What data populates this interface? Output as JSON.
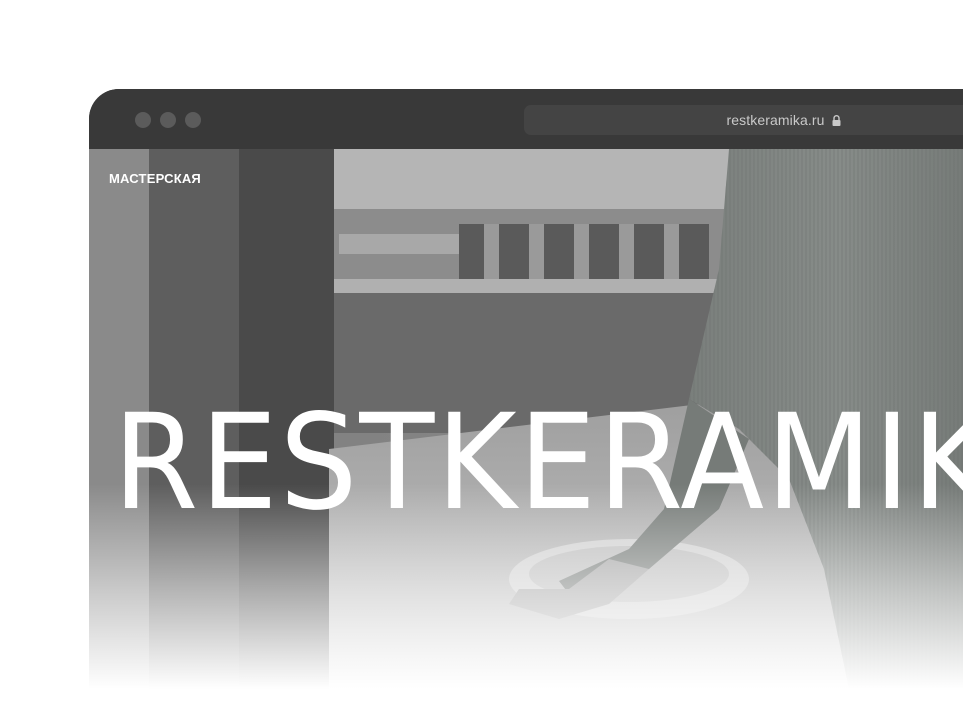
{
  "browser": {
    "url": "restkeramika.ru",
    "window_controls": [
      "close",
      "minimize",
      "maximize"
    ],
    "lock_icon": "lock-icon"
  },
  "site": {
    "nav_label": "МАСТЕРСКАЯ",
    "hero_title": "RESTKERAMIKA"
  },
  "colors": {
    "titlebar": "#393939",
    "address_bar": "#444444",
    "hero_text": "#ffffff"
  }
}
